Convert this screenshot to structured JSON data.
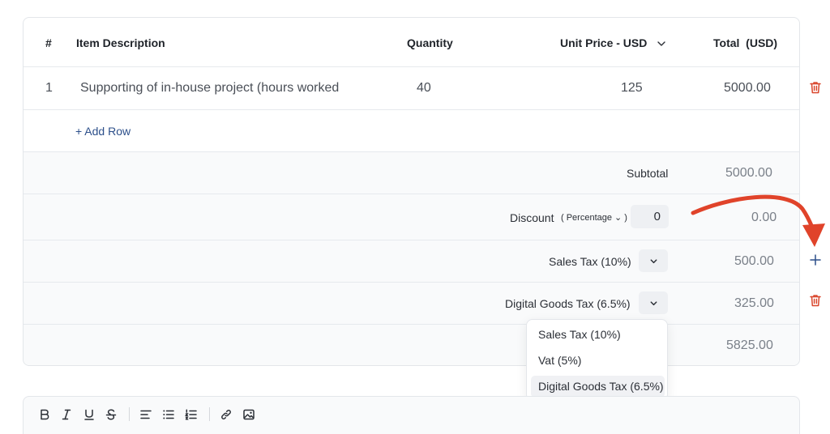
{
  "table": {
    "headers": {
      "number": "#",
      "description": "Item Description",
      "quantity": "Quantity",
      "unit_price": "Unit Price - USD",
      "total": "Total  (USD)"
    },
    "rows": [
      {
        "number": "1",
        "description": "Supporting of in-house project (hours worked",
        "quantity": "40",
        "unit_price": "125",
        "total": "5000.00"
      }
    ],
    "add_row_label": "+ Add Row"
  },
  "summary": {
    "subtotal_label": "Subtotal",
    "subtotal_value": "5000.00",
    "discount_label": "Discount",
    "discount_type": "( Percentage ⌄ )",
    "discount_input": "0",
    "discount_value": "0.00",
    "tax1_label": "Sales Tax (10%)",
    "tax1_value": "500.00",
    "tax2_label": "Digital Goods Tax (6.5%)",
    "tax2_value": "325.00",
    "total_value": "5825.00"
  },
  "tax_dropdown": {
    "options": [
      "Sales Tax (10%)",
      "Vat (5%)",
      "Digital Goods Tax (6.5%)"
    ],
    "selected": "Digital Goods Tax (6.5%)"
  },
  "toolbar": {
    "buttons": [
      "bold",
      "italic",
      "underline",
      "strikethrough",
      "align-left",
      "bullet-list",
      "numbered-list",
      "link",
      "image"
    ]
  },
  "colors": {
    "accent_blue": "#2c4f8a",
    "delete_red": "#d9452b",
    "annotation_arrow": "#e0432a"
  },
  "icons": {
    "delete": "trash-icon",
    "add": "plus-icon",
    "chevron": "chevron-down-icon"
  }
}
